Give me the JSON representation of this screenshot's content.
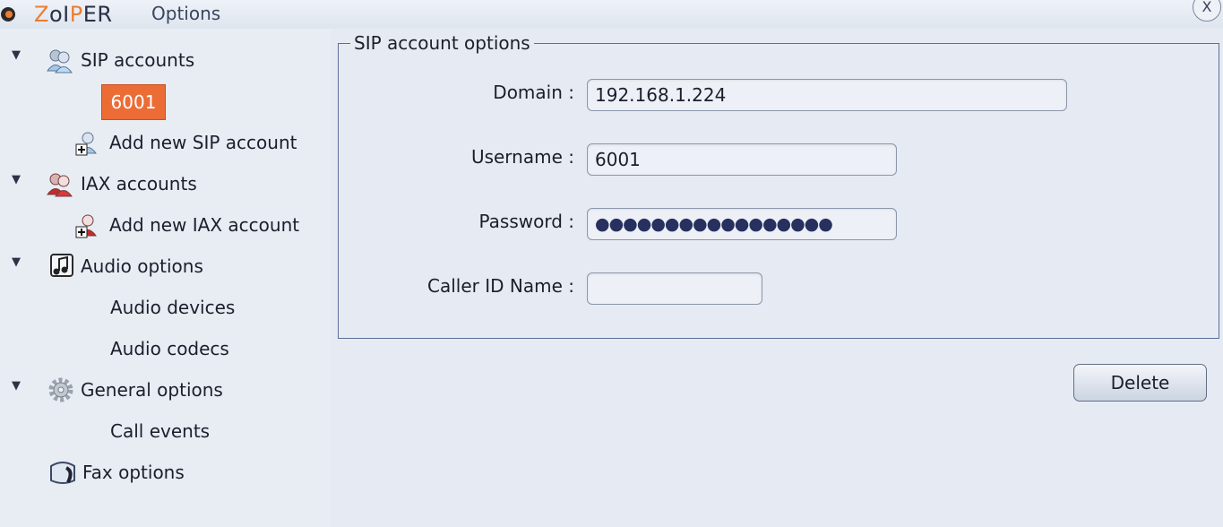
{
  "window": {
    "logo_z": "Z",
    "logo_oi": "oI",
    "logo_p": "P",
    "logo_er": "ER",
    "title": "Options",
    "close_label": "X"
  },
  "sidebar": {
    "sip_accounts": "SIP accounts",
    "sip_selected_account": "6001",
    "add_sip_account": "Add new SIP account",
    "iax_accounts": "IAX accounts",
    "add_iax_account": "Add new IAX account",
    "audio_options": "Audio options",
    "audio_devices": "Audio devices",
    "audio_codecs": "Audio codecs",
    "general_options": "General options",
    "call_events": "Call events",
    "fax_options": "Fax options",
    "expand_arrow": "▼"
  },
  "main": {
    "group_title": "SIP account options",
    "domain_label": "Domain :",
    "domain_value": "192.168.1.224",
    "username_label": "Username :",
    "username_value": "6001",
    "password_label": "Password :",
    "password_value": "●●●●●●●●●●●●●●●●●",
    "caller_id_label": "Caller ID Name :",
    "caller_id_value": "",
    "delete_label": "Delete"
  },
  "colors": {
    "accent": "#ec6c36",
    "window_bg": "#e6ebf3"
  }
}
